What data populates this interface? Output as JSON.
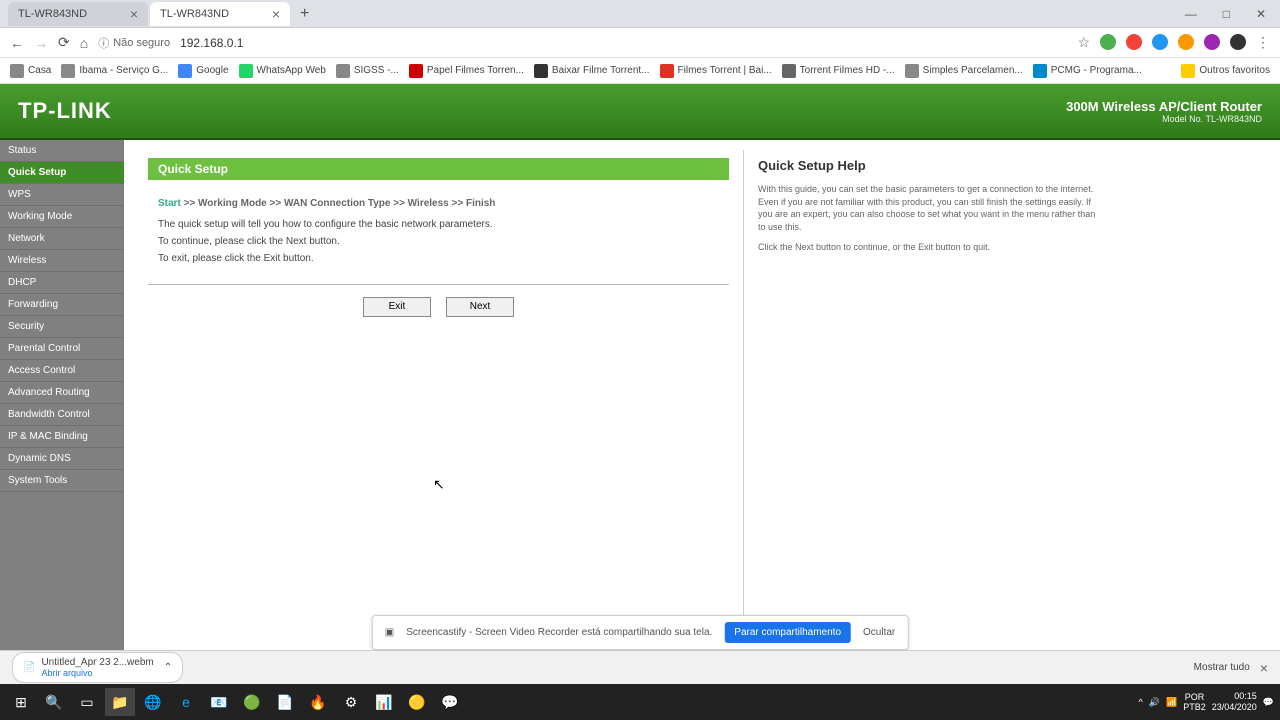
{
  "browser": {
    "tabs": [
      {
        "title": "TL-WR843ND"
      },
      {
        "title": "TL-WR843ND"
      }
    ],
    "security_label": "Não seguro",
    "url": "192.168.0.1",
    "window_controls": {
      "min": "—",
      "max": "□",
      "close": "✕"
    }
  },
  "bookmarks": [
    "Casa",
    "Ibama - Serviço G...",
    "Google",
    "WhatsApp Web",
    "SIGSS -...",
    "Papel Filmes Torren...",
    "Baixar Filme Torrent...",
    "Filmes Torrent | Bai...",
    "Torrent Filmes HD -...",
    "Simples Parcelamen...",
    "PCMG - Programa...",
    "",
    "Outros favoritos"
  ],
  "header": {
    "logo": "TP-LINK",
    "product": "300M Wireless AP/Client Router",
    "model": "Model No. TL-WR843ND"
  },
  "sidebar": {
    "items": [
      "Status",
      "Quick Setup",
      "WPS",
      "Working Mode",
      "Network",
      "Wireless",
      "DHCP",
      "Forwarding",
      "Security",
      "Parental Control",
      "Access Control",
      "Advanced Routing",
      "Bandwidth Control",
      "IP & MAC Binding",
      "Dynamic DNS",
      "System Tools"
    ],
    "active_index": 1
  },
  "content": {
    "title": "Quick Setup",
    "breadcrumb_start": "Start",
    "breadcrumb_rest": " >> Working Mode >> WAN Connection Type >> Wireless >> Finish",
    "line1": "The quick setup will tell you how to configure the basic network parameters.",
    "line2": "To continue, please click the Next button.",
    "line3": "To exit, please click the Exit button.",
    "exit_btn": "Exit",
    "next_btn": "Next"
  },
  "help": {
    "title": "Quick Setup Help",
    "p1": "With this guide, you can set the basic parameters to get a connection to the internet. Even if you are not familiar with this product, you can still finish the settings easily. If you are an expert, you can also choose to set what you want in the menu rather than to use this.",
    "p2": "Click the Next button to continue, or the Exit button to quit."
  },
  "share": {
    "text": "Screencastify - Screen Video Recorder está compartilhando sua tela.",
    "stop": "Parar compartilhamento",
    "hide": "Ocultar"
  },
  "download": {
    "filename": "Untitled_Apr 23 2...webm",
    "subtitle": "Abrir arquivo",
    "show_all": "Mostrar tudo"
  },
  "taskbar": {
    "lang": "POR\nPTB2",
    "time": "00:15",
    "date": "23/04/2020"
  }
}
